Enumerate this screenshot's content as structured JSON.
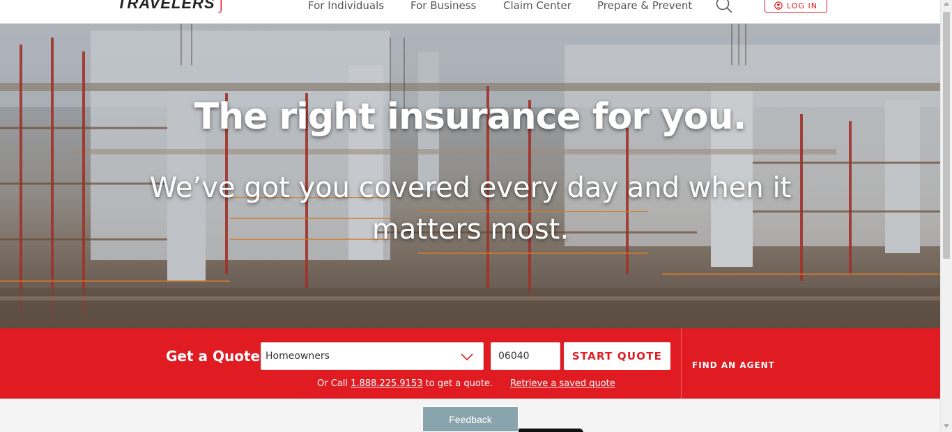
{
  "header": {
    "logo_text": "TRAVELERS",
    "nav": [
      {
        "label": "For Individuals"
      },
      {
        "label": "For Business"
      },
      {
        "label": "Claim Center"
      },
      {
        "label": "Prepare & Prevent"
      }
    ],
    "login_label": "LOG IN"
  },
  "hero": {
    "title": "The right insurance for you.",
    "subtitle": "We’ve got you covered every day and when it matters most."
  },
  "quote": {
    "label": "Get a Quote",
    "product_selected": "Homeowners",
    "zip_value": "06040",
    "start_button": "START QUOTE",
    "call_prefix": "Or Call ",
    "phone": "1.888.225.9153",
    "call_suffix": " to get a quote.",
    "retrieve_link": "Retrieve a saved quote",
    "find_agent": "FIND AN AGENT"
  },
  "feedback": {
    "label": "Feedback"
  },
  "colors": {
    "brand_red": "#e01b22",
    "feedback_bg": "#8aa4ad"
  }
}
